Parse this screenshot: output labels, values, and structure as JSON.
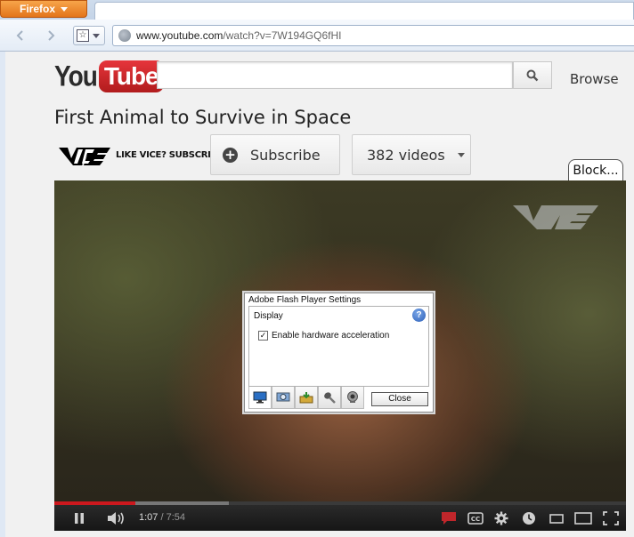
{
  "browser": {
    "menu_label": "Firefox",
    "url_host": "www.youtube.com",
    "url_path": "/watch?v=7W194GQ6fHI"
  },
  "header": {
    "logo_you": "You",
    "logo_tube": "Tube",
    "search_placeholder": "",
    "browse_label": "Browse"
  },
  "video": {
    "title": "First Animal to Survive in Space",
    "channel_tagline": "LIKE VICE? SUBSCRIBE",
    "subscribe_label": "Subscribe",
    "videos_label": "382 videos",
    "block_label": "Block...",
    "current_time": "1:07",
    "duration": " / 7:54",
    "progress_played": 0.141,
    "progress_loaded": 0.305
  },
  "flash_dialog": {
    "title": "Adobe Flash Player Settings",
    "section": "Display",
    "checkbox_label": "Enable hardware acceleration",
    "checkbox_checked": true,
    "checkbox_mark": "✓",
    "help_label": "?",
    "close_label": "Close",
    "tabs": [
      "display-icon",
      "privacy-icon",
      "storage-icon",
      "microphone-icon",
      "camera-icon"
    ]
  },
  "colors": {
    "firefox_orange": "#e3751b",
    "youtube_red": "#cc181e",
    "progress_red": "#cc181e"
  }
}
